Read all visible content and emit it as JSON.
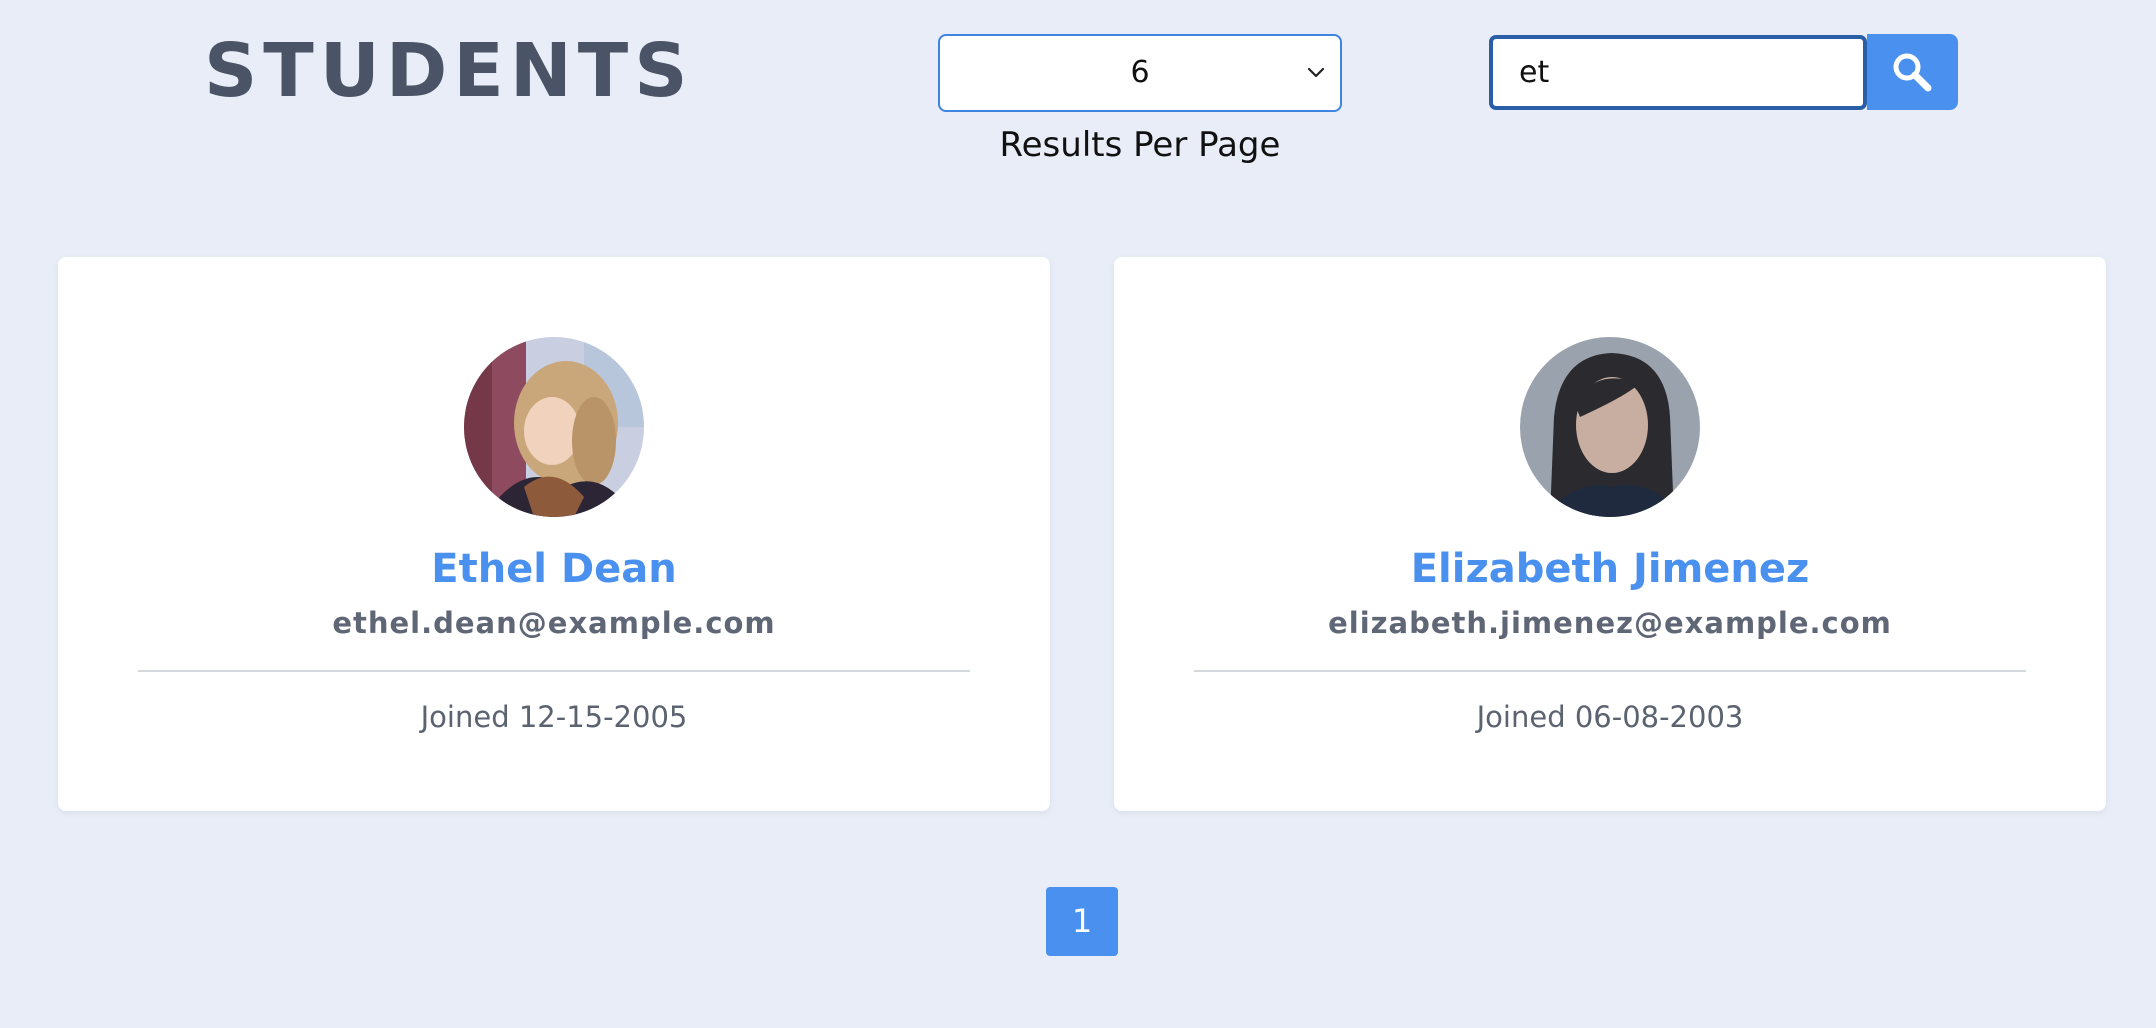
{
  "header": {
    "title": "STUDENTS"
  },
  "controls": {
    "per_page": {
      "selected": "6",
      "label": "Results Per Page"
    },
    "search": {
      "value": "et",
      "button_icon": "search-icon",
      "accent_color": "#4a90ee"
    }
  },
  "students": [
    {
      "name": "Ethel Dean",
      "email": "ethel.dean@example.com",
      "joined": "Joined 12-15-2005",
      "avatar_icon": "avatar-photo"
    },
    {
      "name": "Elizabeth Jimenez",
      "email": "elizabeth.jimenez@example.com",
      "joined": "Joined 06-08-2003",
      "avatar_icon": "avatar-photo"
    }
  ],
  "pagination": {
    "pages": [
      "1"
    ],
    "current": "1"
  }
}
